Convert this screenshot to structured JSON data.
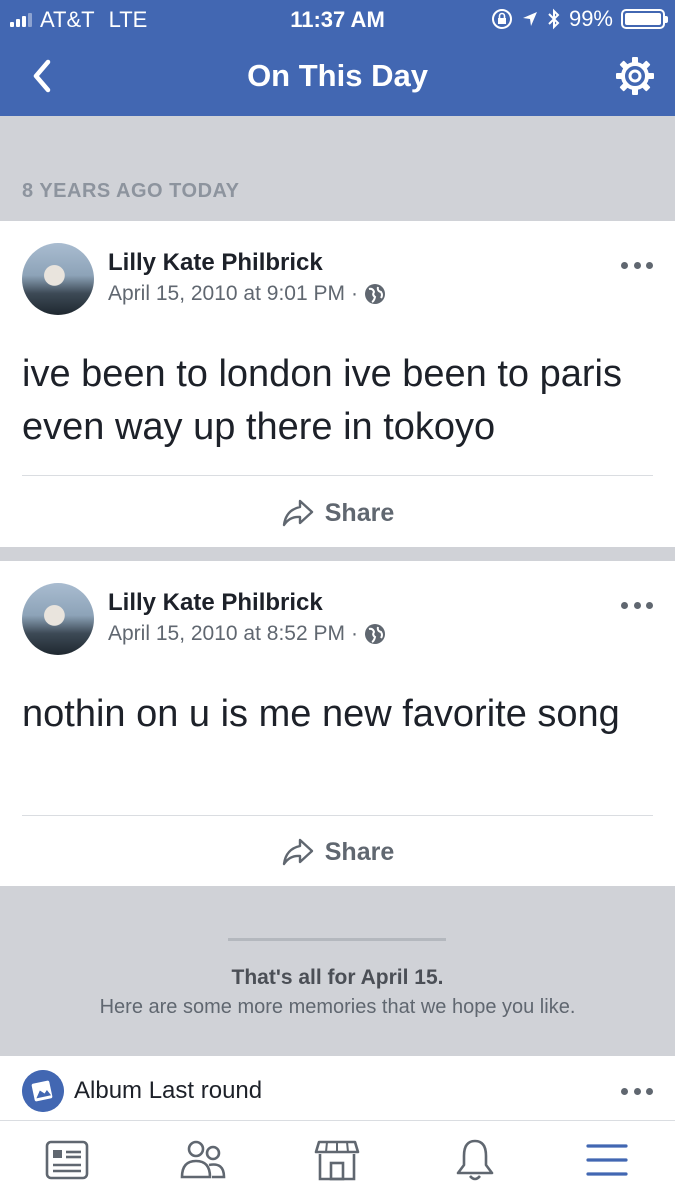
{
  "status_bar": {
    "carrier": "AT&T",
    "network": "LTE",
    "time": "11:37 AM",
    "battery_percent": "99%",
    "battery_level": 0.99
  },
  "nav": {
    "title": "On This Day",
    "back_icon": "chevron-left-icon",
    "settings_icon": "gear-icon"
  },
  "section": {
    "header": "8 YEARS AGO TODAY"
  },
  "posts": [
    {
      "author": "Lilly Kate Philbrick",
      "timestamp": "April 15, 2010 at 9:01 PM",
      "separator": "·",
      "text": "ive been to london ive been to paris even way up there in tokoyo",
      "share_label": "Share"
    },
    {
      "author": "Lilly Kate Philbrick",
      "timestamp": "April 15, 2010 at 8:52 PM",
      "separator": "·",
      "text": "nothin on u is me new favorite song",
      "share_label": "Share"
    }
  ],
  "end_notice": {
    "title": "That's all for April 15.",
    "subtitle": "Here are some more memories that we hope you like."
  },
  "album": {
    "label": "Album Last round"
  },
  "tabs": [
    "news-feed-icon",
    "friends-icon",
    "marketplace-icon",
    "notifications-icon",
    "menu-icon"
  ],
  "colors": {
    "brand": "#4267b2",
    "background": "#d0d2d7",
    "text": "#1d2129",
    "secondary_text": "#606770"
  }
}
